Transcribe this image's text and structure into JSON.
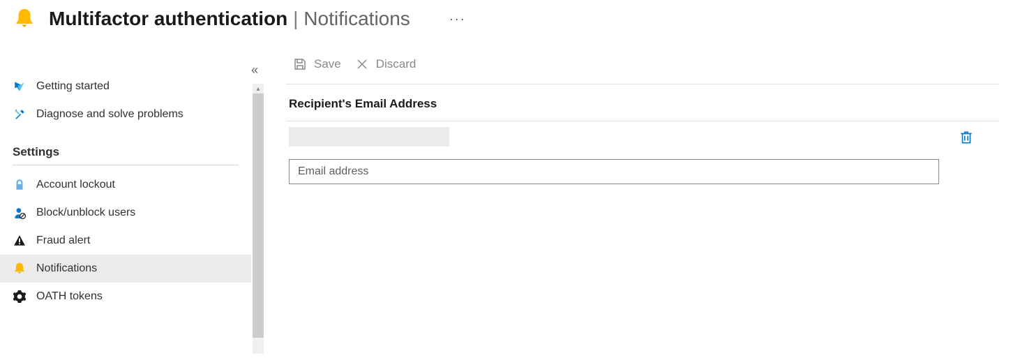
{
  "header": {
    "title": "Multifactor authentication",
    "separator": "|",
    "subtitle": "Notifications",
    "more": "···"
  },
  "sidebar": {
    "items": [
      {
        "label": "Getting started"
      },
      {
        "label": "Diagnose and solve problems"
      }
    ],
    "settings_header": "Settings",
    "settings": [
      {
        "label": "Account lockout"
      },
      {
        "label": "Block/unblock users"
      },
      {
        "label": "Fraud alert"
      },
      {
        "label": "Notifications"
      },
      {
        "label": "OATH tokens"
      }
    ]
  },
  "toolbar": {
    "save_label": "Save",
    "discard_label": "Discard"
  },
  "content": {
    "recipients_label": "Recipient's Email Address",
    "rows": [
      {
        "value": ""
      }
    ],
    "input_placeholder": "Email address"
  }
}
